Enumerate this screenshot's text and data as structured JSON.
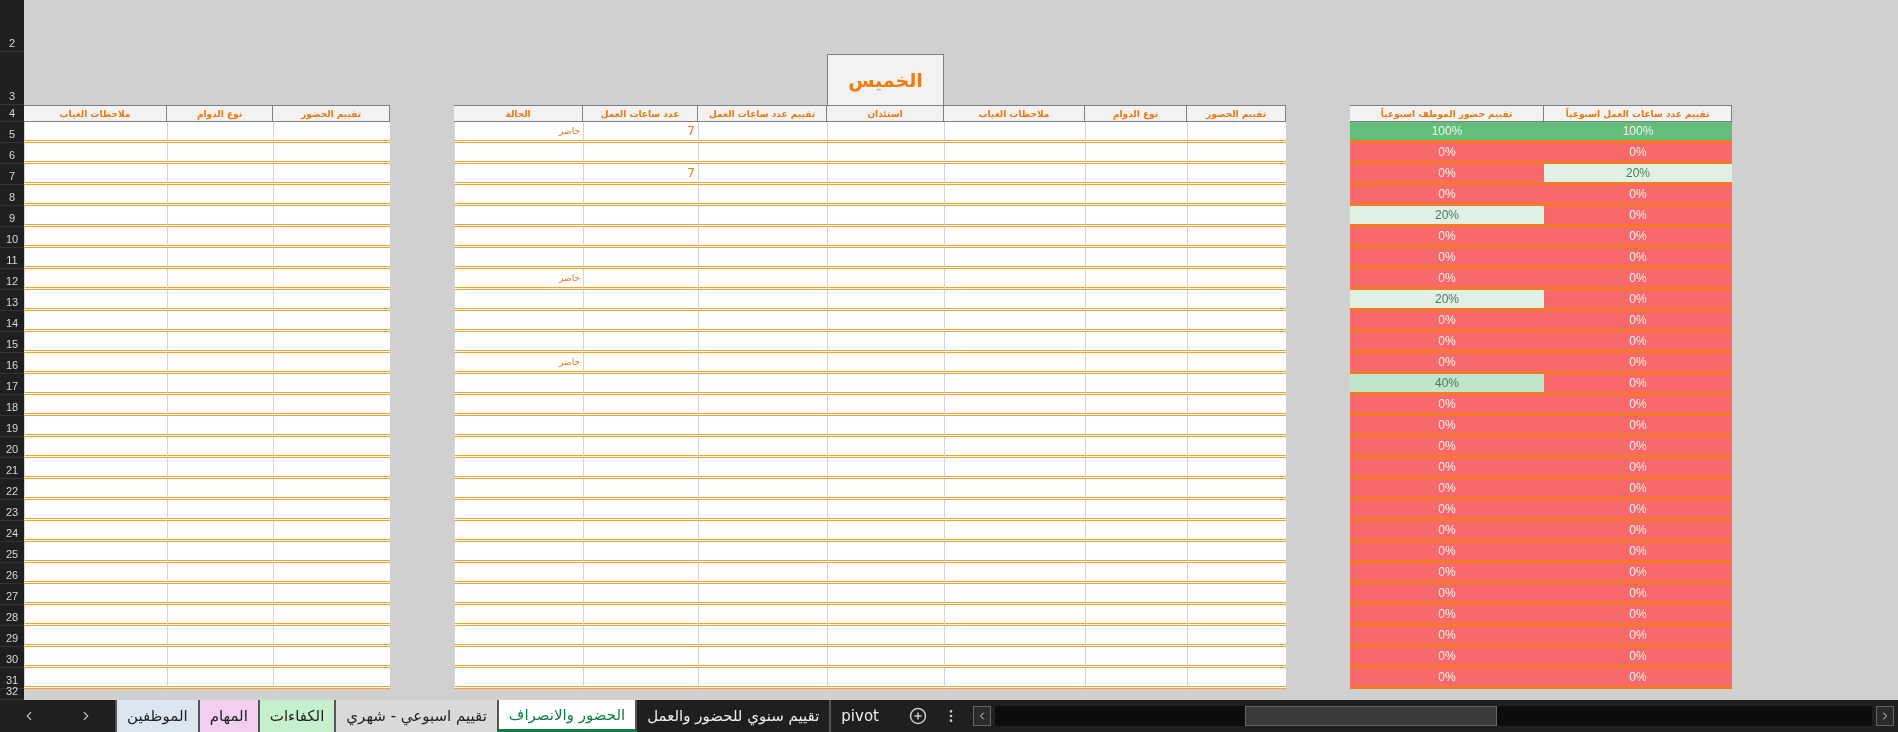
{
  "row_numbers": [
    "2",
    "3",
    "4",
    "5",
    "6",
    "7",
    "8",
    "9",
    "10",
    "11",
    "12",
    "13",
    "14",
    "15",
    "16",
    "17",
    "18",
    "19",
    "20",
    "21",
    "22",
    "23",
    "24",
    "25",
    "26",
    "27",
    "28",
    "29",
    "30",
    "31",
    "32"
  ],
  "day_title": "الخميس",
  "notes_table": {
    "columns": [
      "تقييم الحضور",
      "نوع الدوام",
      "ملاحظات الغياب"
    ]
  },
  "attendance_table": {
    "columns": [
      "تقييم الحضور",
      "نوع الدوام",
      "ملاحظات الغياب",
      "استئذان",
      "تقييم عدد ساعات العمل",
      "عدد ساعات العمل",
      "الحالة"
    ],
    "rows": [
      {
        "status": "حاضر",
        "work_hours": "7"
      },
      {},
      {
        "work_hours": "7"
      },
      {},
      {},
      {},
      {},
      {
        "status": "حاضر"
      },
      {},
      {},
      {},
      {
        "status": "حاضر"
      },
      {},
      {},
      {},
      {},
      {},
      {},
      {},
      {},
      {},
      {},
      {},
      {},
      {},
      {},
      {}
    ]
  },
  "weekly_rating_table": {
    "columns": [
      "تقييم عدد ساعات العمل اسبوعياً",
      "تقييم حضور الموظف اسبوعياً"
    ],
    "rows": [
      {
        "hours_rating": {
          "text": "100%",
          "color": "#63be7b"
        },
        "attendance_rating": {
          "text": "100%",
          "color": "#63be7b"
        }
      },
      {
        "hours_rating": {
          "text": "0%",
          "color": "#f8696b"
        },
        "attendance_rating": {
          "text": "0%",
          "color": "#f8696b"
        }
      },
      {
        "hours_rating": {
          "text": "20%",
          "color": "#e0f0e4"
        },
        "attendance_rating": {
          "text": "0%",
          "color": "#f8696b"
        }
      },
      {
        "hours_rating": {
          "text": "0%",
          "color": "#f8696b"
        },
        "attendance_rating": {
          "text": "0%",
          "color": "#f8696b"
        }
      },
      {
        "hours_rating": {
          "text": "0%",
          "color": "#f8696b"
        },
        "attendance_rating": {
          "text": "20%",
          "color": "#e0f0e4"
        }
      },
      {
        "hours_rating": {
          "text": "0%",
          "color": "#f8696b"
        },
        "attendance_rating": {
          "text": "0%",
          "color": "#f8696b"
        }
      },
      {
        "hours_rating": {
          "text": "0%",
          "color": "#f8696b"
        },
        "attendance_rating": {
          "text": "0%",
          "color": "#f8696b"
        }
      },
      {
        "hours_rating": {
          "text": "0%",
          "color": "#f8696b"
        },
        "attendance_rating": {
          "text": "0%",
          "color": "#f8696b"
        }
      },
      {
        "hours_rating": {
          "text": "0%",
          "color": "#f8696b"
        },
        "attendance_rating": {
          "text": "20%",
          "color": "#e0f0e4"
        }
      },
      {
        "hours_rating": {
          "text": "0%",
          "color": "#f8696b"
        },
        "attendance_rating": {
          "text": "0%",
          "color": "#f8696b"
        }
      },
      {
        "hours_rating": {
          "text": "0%",
          "color": "#f8696b"
        },
        "attendance_rating": {
          "text": "0%",
          "color": "#f8696b"
        }
      },
      {
        "hours_rating": {
          "text": "0%",
          "color": "#f8696b"
        },
        "attendance_rating": {
          "text": "0%",
          "color": "#f8696b"
        }
      },
      {
        "hours_rating": {
          "text": "0%",
          "color": "#f8696b"
        },
        "attendance_rating": {
          "text": "40%",
          "color": "#c0e5cb"
        }
      },
      {
        "hours_rating": {
          "text": "0%",
          "color": "#f8696b"
        },
        "attendance_rating": {
          "text": "0%",
          "color": "#f8696b"
        }
      },
      {
        "hours_rating": {
          "text": "0%",
          "color": "#f8696b"
        },
        "attendance_rating": {
          "text": "0%",
          "color": "#f8696b"
        }
      },
      {
        "hours_rating": {
          "text": "0%",
          "color": "#f8696b"
        },
        "attendance_rating": {
          "text": "0%",
          "color": "#f8696b"
        }
      },
      {
        "hours_rating": {
          "text": "0%",
          "color": "#f8696b"
        },
        "attendance_rating": {
          "text": "0%",
          "color": "#f8696b"
        }
      },
      {
        "hours_rating": {
          "text": "0%",
          "color": "#f8696b"
        },
        "attendance_rating": {
          "text": "0%",
          "color": "#f8696b"
        }
      },
      {
        "hours_rating": {
          "text": "0%",
          "color": "#f8696b"
        },
        "attendance_rating": {
          "text": "0%",
          "color": "#f8696b"
        }
      },
      {
        "hours_rating": {
          "text": "0%",
          "color": "#f8696b"
        },
        "attendance_rating": {
          "text": "0%",
          "color": "#f8696b"
        }
      },
      {
        "hours_rating": {
          "text": "0%",
          "color": "#f8696b"
        },
        "attendance_rating": {
          "text": "0%",
          "color": "#f8696b"
        }
      },
      {
        "hours_rating": {
          "text": "0%",
          "color": "#f8696b"
        },
        "attendance_rating": {
          "text": "0%",
          "color": "#f8696b"
        }
      },
      {
        "hours_rating": {
          "text": "0%",
          "color": "#f8696b"
        },
        "attendance_rating": {
          "text": "0%",
          "color": "#f8696b"
        }
      },
      {
        "hours_rating": {
          "text": "0%",
          "color": "#f8696b"
        },
        "attendance_rating": {
          "text": "0%",
          "color": "#f8696b"
        }
      },
      {
        "hours_rating": {
          "text": "0%",
          "color": "#f8696b"
        },
        "attendance_rating": {
          "text": "0%",
          "color": "#f8696b"
        }
      },
      {
        "hours_rating": {
          "text": "0%",
          "color": "#f8696b"
        },
        "attendance_rating": {
          "text": "0%",
          "color": "#f8696b"
        }
      },
      {
        "hours_rating": {
          "text": "0%",
          "color": "#f8696b"
        },
        "attendance_rating": {
          "text": "0%",
          "color": "#f8696b"
        }
      }
    ]
  },
  "sheet_tabs": [
    {
      "label": "pivot",
      "selected": false
    },
    {
      "label": "تقييم سنوي للحضور والعمل",
      "selected": false
    },
    {
      "label": "الحضور والانصراف",
      "selected": true
    },
    {
      "label": "تقييم اسبوعي - شهري",
      "selected": false,
      "color": "#d9d9d9"
    },
    {
      "label": "الكفاءات",
      "selected": false,
      "color": "#c6efce"
    },
    {
      "label": "المهام",
      "selected": false,
      "color": "#f2ceef"
    },
    {
      "label": "الموظفين",
      "selected": false,
      "color": "#dce6f1"
    }
  ]
}
